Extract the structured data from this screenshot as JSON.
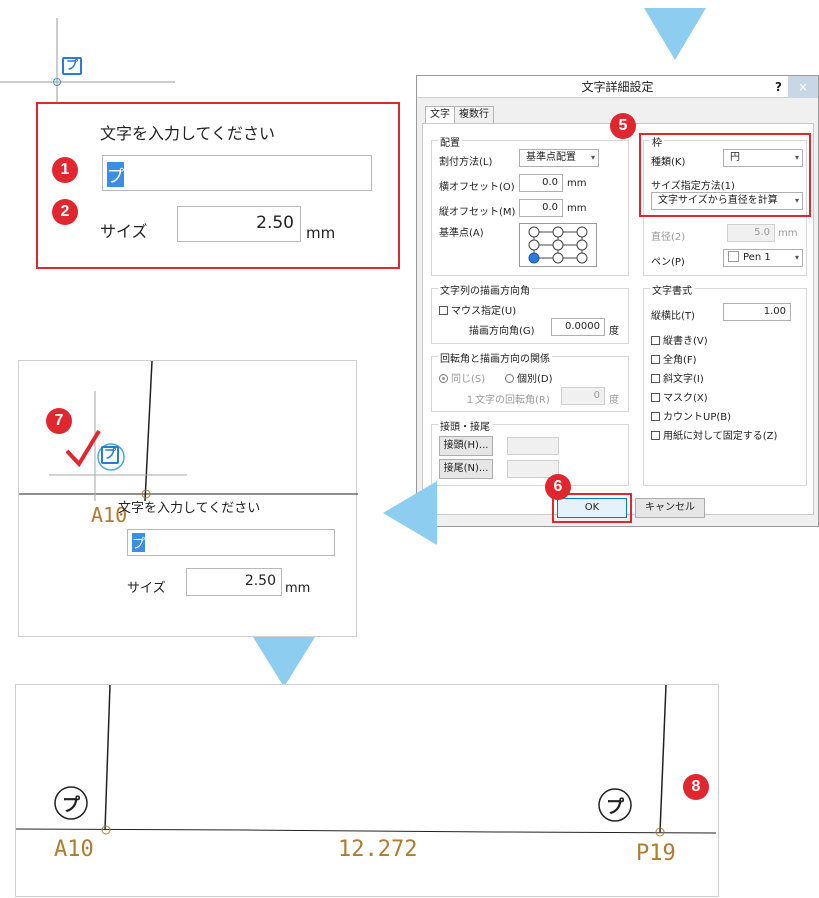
{
  "top_panel": {
    "prompt": "文字を入力してください",
    "text_value": "プ",
    "size_label": "サイズ",
    "size_value": "2.50",
    "size_unit": "mm",
    "badge_1": "1",
    "badge_2": "2"
  },
  "dialog": {
    "title": "文字詳細設定",
    "help": "?",
    "close": "×",
    "tabs": [
      "文字",
      "複数行"
    ],
    "layout_group": "配置",
    "assign_method_label": "割付方法(L)",
    "assign_method_value": "基準点配置",
    "x_offset_label": "横オフセット(O)",
    "x_offset_value": "0.0",
    "y_offset_label": "縦オフセット(M)",
    "y_offset_value": "0.0",
    "unit_mm": "mm",
    "base_point_label": "基準点(A)",
    "frame_group": "枠",
    "kind_label": "種類(K)",
    "kind_value": "円",
    "size_method_label": "サイズ指定方法(1)",
    "size_method_value": "文字サイズから直径を計算",
    "diameter_label": "直径(2)",
    "diameter_value": "5.0",
    "pen_label": "ペン(P)",
    "pen_value": "Pen 1",
    "angle_group": "文字列の描画方向角",
    "mouse_spec": "マウス指定(U)",
    "draw_angle_label": "描画方向角(G)",
    "draw_angle_value": "0.0000",
    "deg": "度",
    "relation_group": "回転角と描画方向の関係",
    "same": "同じ(S)",
    "individual": "個別(D)",
    "char_rot_label": "１文字の回転角(R)",
    "char_rot_value": "0",
    "prefix_group": "接頭・接尾",
    "prefix_btn": "接頭(H)...",
    "suffix_btn": "接尾(N)...",
    "format_group": "文字書式",
    "aspect_label": "縦横比(T)",
    "aspect_value": "1.00",
    "vertical": "縦書き(V)",
    "fullwidth": "全角(F)",
    "italic": "斜文字(I)",
    "mask": "マスク(X)",
    "countup": "カウントUP(B)",
    "fixed_paper": "用紙に対して固定する(Z)",
    "ok": "OK",
    "cancel": "キャンセル",
    "badge_5": "5",
    "badge_6": "6"
  },
  "mid_panel": {
    "prompt": "文字を入力してください",
    "text_value": "プ",
    "size_label": "サイズ",
    "size_value": "2.50",
    "size_unit": "mm",
    "point_label": "A10",
    "badge_7": "7"
  },
  "bottom_panel": {
    "left_point": "A10",
    "distance": "12.272",
    "right_point": "P19",
    "circle_char": "プ",
    "badge_8": "8"
  },
  "colors": {
    "accent_red": "#e0262e",
    "arrow_blue": "#8ccdf0",
    "cad_brown": "#b07a30",
    "select_blue": "#3a8ee6"
  }
}
